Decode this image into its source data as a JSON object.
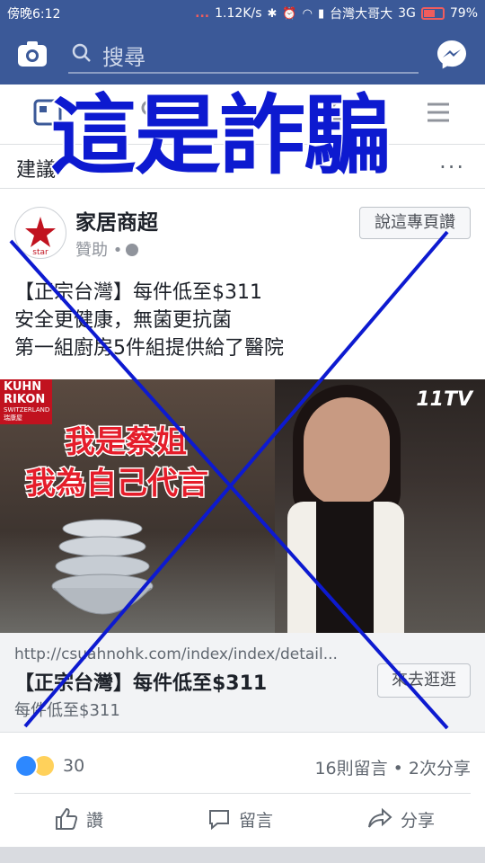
{
  "status_bar": {
    "time": "傍晚6:12",
    "dots": "...",
    "speed": "1.12K/s",
    "carrier": "台灣大哥大",
    "network": "3G",
    "battery": "79%"
  },
  "app_bar": {
    "search_placeholder": "搜尋"
  },
  "overlay": {
    "title": "這是詐騙"
  },
  "suggestion": {
    "label": "建議",
    "more": "..."
  },
  "post": {
    "page_name": "家居商超",
    "sponsored": "贊助 •",
    "like_page_button": "說這專頁讚",
    "avatar_text": "star",
    "text_lines": [
      "【正宗台灣】每件低至$311",
      "安全更健康，無菌更抗菌",
      "第一組廚房5件組提供給了醫院"
    ],
    "image": {
      "brand_top": "KUHN RIKON",
      "brand_sub": "SWITZERLAND 瑞康屋",
      "caption_1": "我是蔡姐",
      "caption_2": "我為自己代言",
      "channel": "11TV"
    },
    "link": {
      "url": "http://csuahnohk.com/index/index/detail...",
      "title": "【正宗台灣】每件低至$311",
      "description": "每件低至$311",
      "cta": "來去逛逛"
    },
    "reaction_count": "30",
    "comments_shares": "16則留言 • 2次分享",
    "actions": {
      "like": "讚",
      "comment": "留言",
      "share": "分享"
    }
  },
  "colors": {
    "facebook_blue": "#3b5998",
    "overlay_blue": "#0d1ad0"
  }
}
